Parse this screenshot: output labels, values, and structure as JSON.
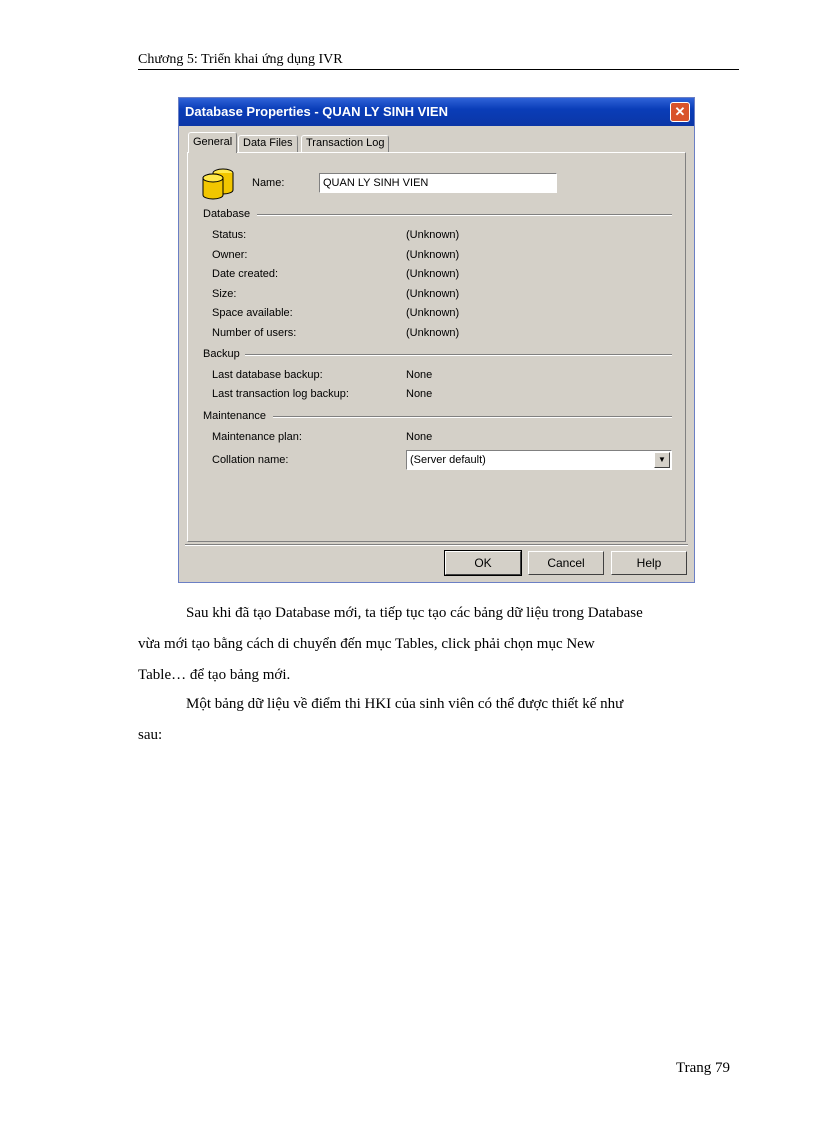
{
  "header": {
    "title": "Chương 5: Triển khai ứng dụng IVR"
  },
  "dialog": {
    "title": "Database Properties - QUAN LY SINH VIEN",
    "close_glyph": "✕",
    "tabs": [
      "General",
      "Data Files",
      "Transaction Log"
    ],
    "name_label": "Name:",
    "name_value": "QUAN LY SINH VIEN",
    "database_group": "Database",
    "database_rows": [
      {
        "label": "Status:",
        "value": "(Unknown)"
      },
      {
        "label": "Owner:",
        "value": "(Unknown)"
      },
      {
        "label": "Date created:",
        "value": "(Unknown)"
      },
      {
        "label": "Size:",
        "value": "(Unknown)"
      },
      {
        "label": "Space available:",
        "value": "(Unknown)"
      },
      {
        "label": "Number of users:",
        "value": "(Unknown)"
      }
    ],
    "backup_group": "Backup",
    "backup_rows": [
      {
        "label": "Last database backup:",
        "value": "None"
      },
      {
        "label": "Last transaction log backup:",
        "value": "None"
      }
    ],
    "maintenance_group": "Maintenance",
    "maintenance_plan_label": "Maintenance plan:",
    "maintenance_plan_value": "None",
    "collation_label": "Collation name:",
    "collation_value": "(Server default)",
    "buttons": {
      "ok": "OK",
      "cancel": "Cancel",
      "help": "Help"
    }
  },
  "body": {
    "paragraph1": [
      "Sau khi đã tạo Database mới, ta tiếp tục tạo các bảng dữ liệu trong Database",
      "vừa mới tạo bằng cách di chuyển đến mục Tables, click phải chọn mục New",
      "Table… để tạo bảng mới."
    ],
    "paragraph2": [
      "Một bảng dữ liệu về điểm thi HKI của sinh viên có thể được thiết kế như",
      "sau:"
    ]
  },
  "footer": {
    "page_number": "Trang 79"
  },
  "colors": {
    "titlebar": "#0a3db8",
    "dialog_bg": "#d4d0c8",
    "close_button": "#d9532b"
  }
}
